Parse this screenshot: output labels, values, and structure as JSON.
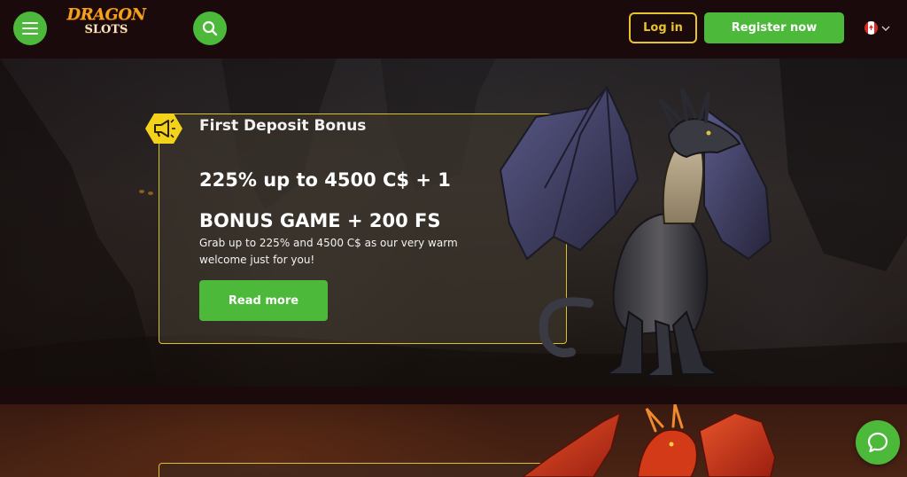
{
  "header": {
    "logo": {
      "line1": "DRAGON",
      "line2": "SLOTS"
    },
    "login_label": "Log in",
    "register_label": "Register now"
  },
  "promo": {
    "label": "First Deposit Bonus",
    "title_line1": "225% up to 4500 C$ + 1",
    "title_line2": "BONUS GAME + 200 FS",
    "description": "Grab up to 225% and 4500 C$ as our very warm welcome just for you!",
    "cta_label": "Read more"
  },
  "icons": [
    "menu-icon",
    "search-icon",
    "canada-flag-icon",
    "chevron-down-icon",
    "megaphone-icon",
    "chat-icon"
  ],
  "colors": {
    "accent_green": "#4cb93a",
    "accent_gold": "#e8c42c",
    "background": "#1a0a0c"
  }
}
